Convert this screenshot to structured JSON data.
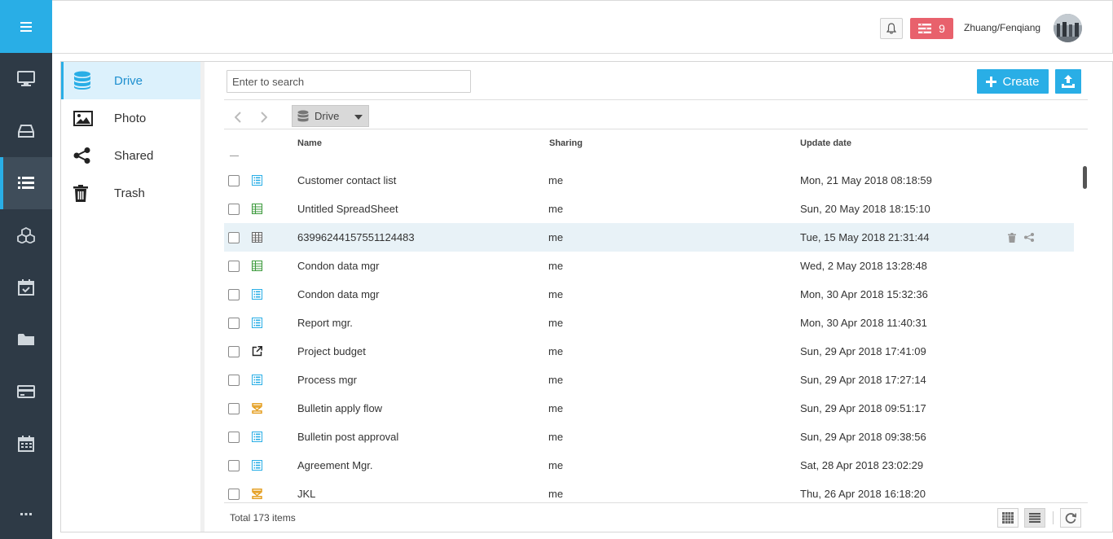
{
  "header": {
    "notification_count": "9",
    "user_name": "Zhuang/Fenqiang"
  },
  "rail": {
    "items": [
      {
        "icon": "monitor-icon"
      },
      {
        "icon": "drive-icon"
      },
      {
        "icon": "list-icon",
        "active": true
      },
      {
        "icon": "cubes-icon"
      },
      {
        "icon": "calendar-check-icon"
      },
      {
        "icon": "folder-icon"
      },
      {
        "icon": "card-icon"
      },
      {
        "icon": "calendar-icon"
      }
    ],
    "more_label": "···"
  },
  "sidebar": {
    "items": [
      {
        "label": "Drive",
        "icon": "database-icon",
        "active": true
      },
      {
        "label": "Photo",
        "icon": "image-icon"
      },
      {
        "label": "Shared",
        "icon": "share-icon"
      },
      {
        "label": "Trash",
        "icon": "trash-icon"
      }
    ]
  },
  "toolbar": {
    "search_placeholder": "Enter to search",
    "create_label": "Create",
    "location_label": "Drive"
  },
  "table": {
    "columns": {
      "name": "Name",
      "sharing": "Sharing",
      "date": "Update date"
    },
    "rows": [
      {
        "name": "Customer contact list",
        "sharing": "me",
        "date": "Mon, 21 May 2018 08:18:59",
        "type": "form"
      },
      {
        "name": "Untitled SpreadSheet",
        "sharing": "me",
        "date": "Sun, 20 May 2018 18:15:10",
        "type": "sheet"
      },
      {
        "name": "63996244157551124483",
        "sharing": "me",
        "date": "Tue, 15 May 2018 21:31:44",
        "type": "table",
        "highlighted": true
      },
      {
        "name": "Condon data mgr",
        "sharing": "me",
        "date": "Wed, 2 May 2018 13:28:48",
        "type": "sheet"
      },
      {
        "name": "Condon data mgr",
        "sharing": "me",
        "date": "Mon, 30 Apr 2018 15:32:36",
        "type": "form"
      },
      {
        "name": "Report mgr.",
        "sharing": "me",
        "date": "Mon, 30 Apr 2018 11:40:31",
        "type": "form"
      },
      {
        "name": "Project budget",
        "sharing": "me",
        "date": "Sun, 29 Apr 2018 17:41:09",
        "type": "link"
      },
      {
        "name": "Process mgr",
        "sharing": "me",
        "date": "Sun, 29 Apr 2018 17:27:14",
        "type": "form"
      },
      {
        "name": "Bulletin apply flow",
        "sharing": "me",
        "date": "Sun, 29 Apr 2018 09:51:17",
        "type": "flow"
      },
      {
        "name": "Bulletin post approval",
        "sharing": "me",
        "date": "Sun, 29 Apr 2018 09:38:56",
        "type": "form"
      },
      {
        "name": "Agreement Mgr.",
        "sharing": "me",
        "date": "Sat, 28 Apr 2018 23:02:29",
        "type": "form"
      },
      {
        "name": "JKL",
        "sharing": "me",
        "date": "Thu, 26 Apr 2018 16:18:20",
        "type": "flow"
      }
    ]
  },
  "footer": {
    "total_label": "Total 173 items"
  },
  "colors": {
    "accent": "#29aee6",
    "rail_bg": "#2e3a46",
    "notification": "#e8616c"
  }
}
